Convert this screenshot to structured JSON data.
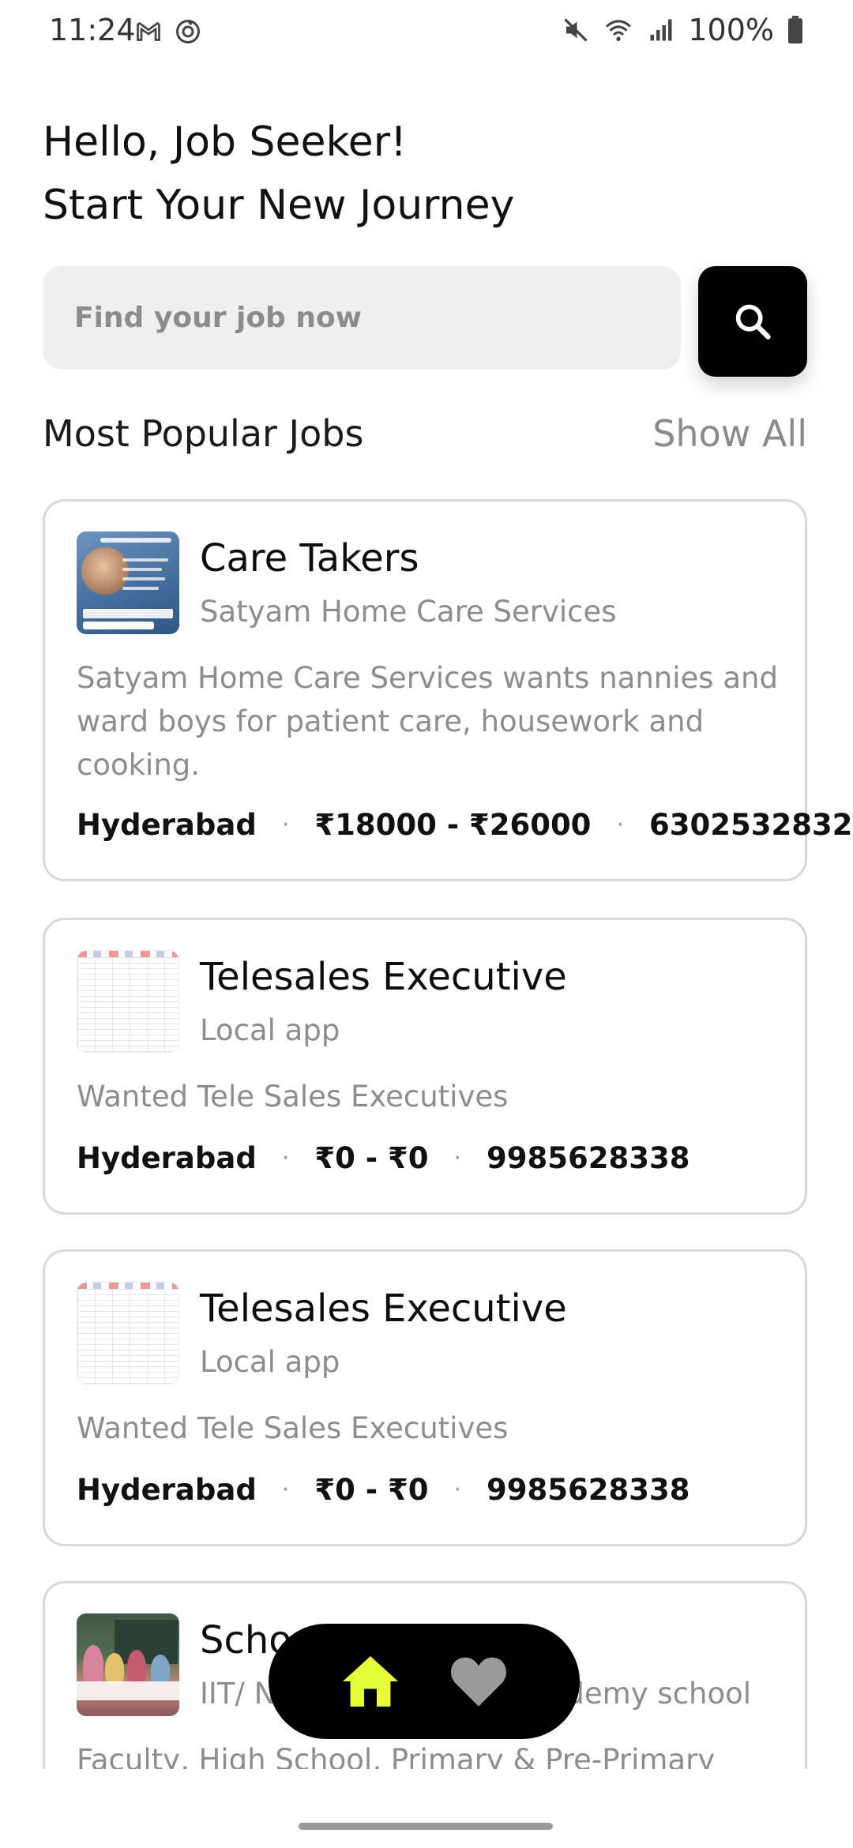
{
  "status_bar": {
    "time": "11:24",
    "battery": "100%",
    "left_icons": [
      "gmail-icon",
      "sync-icon"
    ],
    "right_icons": [
      "mute-icon",
      "wifi-icon",
      "signal-icon",
      "battery-icon"
    ]
  },
  "header": {
    "greeting_line1": "Hello, Job Seeker!",
    "greeting_line2": "Start Your New Journey"
  },
  "search": {
    "placeholder": "Find your job now",
    "button_icon": "search-icon"
  },
  "popular": {
    "title": "Most Popular Jobs",
    "show_all": "Show All"
  },
  "jobs": [
    {
      "title": "Care Takers",
      "company": "Satyam Home Care Services",
      "description": "Satyam Home Care Services wants nannies and ward boys for patient care, housework and cooking.",
      "location": "Hyderabad",
      "salary": "₹18000 - ₹26000",
      "phone": "6302532832"
    },
    {
      "title": "Telesales Executive",
      "company": "Local app",
      "description": "Wanted Tele Sales Executives",
      "location": "Hyderabad",
      "salary": "₹0 - ₹0",
      "phone": "9985628338"
    },
    {
      "title": "Telesales Executive",
      "company": "Local app",
      "description": "Wanted Tele Sales Executives",
      "location": "Hyderabad",
      "salary": "₹0 - ₹0",
      "phone": "9985628338"
    },
    {
      "title": "School Teachers",
      "company": "IIT/ NEET Foundation Academy school",
      "description": "Faculty, High School, Primary & Pre-Primary"
    }
  ],
  "bottom_nav": {
    "items": [
      "home-icon",
      "heart-icon"
    ],
    "active": "home-icon",
    "active_color": "#e4ff3a",
    "inactive_color": "#9a9a9a"
  }
}
